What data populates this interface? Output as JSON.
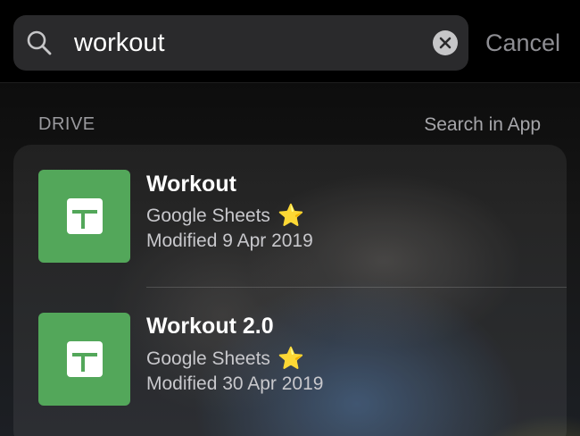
{
  "search": {
    "query": "workout",
    "cancel_label": "Cancel"
  },
  "section": {
    "title": "DRIVE",
    "action_label": "Search in App"
  },
  "results": [
    {
      "title": "Workout",
      "app": "Google Sheets",
      "modified": "Modified 9 Apr 2019",
      "starred": true,
      "icon": "google-sheets-icon"
    },
    {
      "title": "Workout 2.0",
      "app": "Google Sheets",
      "modified": "Modified 30 Apr 2019",
      "starred": true,
      "icon": "google-sheets-icon"
    }
  ],
  "colors": {
    "sheets_green": "#53a75a",
    "star": "#f5c518"
  }
}
